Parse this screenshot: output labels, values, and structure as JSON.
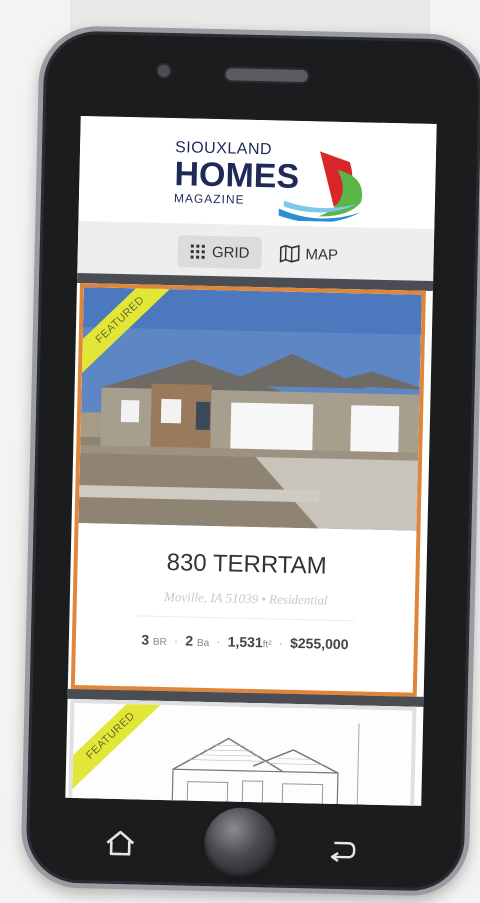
{
  "logo": {
    "line1": "SIOUXLAND",
    "line2": "HOMES",
    "line3": "MAGAZINE"
  },
  "view_toggle": {
    "grid_label": "GRID",
    "grid_icon": "grid-icon",
    "map_label": "MAP",
    "map_icon": "map-icon"
  },
  "listings": [
    {
      "ribbon": "FEATURED",
      "title": "830 TERRTAM",
      "subtitle": "Moville, IA 51039 • Residential",
      "beds": "3",
      "beds_unit": "BR",
      "baths": "2",
      "baths_unit": "Ba",
      "sqft": "1,531",
      "sqft_unit": "ft²",
      "price": "$255,000"
    },
    {
      "ribbon": "FEATURED"
    }
  ],
  "colors": {
    "featured_border": "#e0863a",
    "ribbon": "#e2e637",
    "logo_navy": "#1f2a5a",
    "logo_red": "#d9262b",
    "logo_green": "#5bb648",
    "logo_blue": "#2a8fd0"
  },
  "nav": {
    "home_icon": "home-icon",
    "back_icon": "back-icon"
  }
}
